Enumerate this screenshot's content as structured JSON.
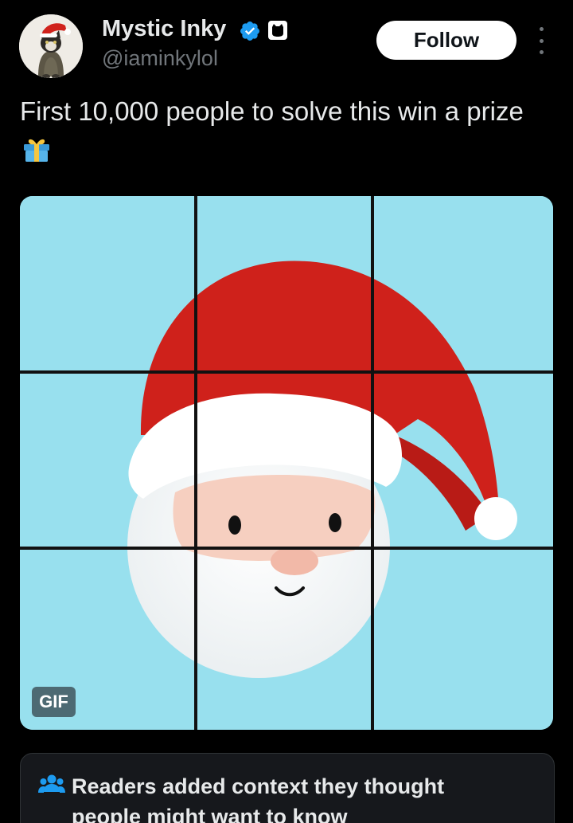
{
  "author": {
    "name": "Mystic Inky",
    "handle": "@iaminkylol",
    "verified_icon": "verified-badge-icon",
    "affiliate_icon": "cat-badge-icon"
  },
  "actions": {
    "follow_label": "Follow",
    "more_icon": "more-vertical-icon"
  },
  "tweet": {
    "text": "First 10,000 people to solve this win a prize",
    "emoji": "wrapped-gift-icon"
  },
  "media": {
    "badge": "GIF",
    "grid_rows": 3,
    "grid_cols": 3
  },
  "note": {
    "icon": "people-icon",
    "text": "Readers added context they thought people might want to know"
  },
  "colors": {
    "background": "#000000",
    "text": "#e7e9ea",
    "muted": "#71767b",
    "verified": "#1d9bf0",
    "puzzle_bg": "#98e0ee",
    "hat_red": "#d0221c",
    "note_bg": "#16181c",
    "people_icon": "#1d9bf0"
  }
}
